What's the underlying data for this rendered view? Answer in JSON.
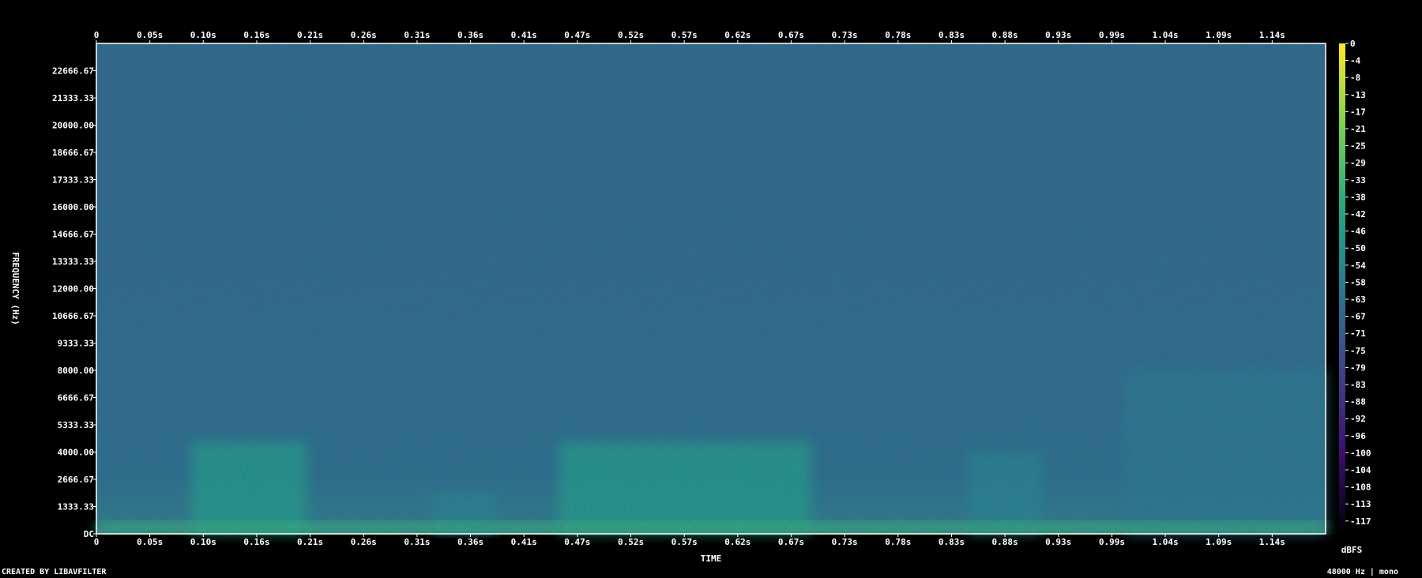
{
  "chart_data": {
    "type": "heatmap",
    "title": "",
    "xlabel": "TIME",
    "ylabel": "FREQUENCY (Hz)",
    "x_ticks": [
      "0",
      "0.05s",
      "0.10s",
      "0.16s",
      "0.21s",
      "0.26s",
      "0.31s",
      "0.36s",
      "0.41s",
      "0.47s",
      "0.52s",
      "0.57s",
      "0.62s",
      "0.67s",
      "0.73s",
      "0.78s",
      "0.83s",
      "0.88s",
      "0.93s",
      "0.99s",
      "1.04s",
      "1.09s",
      "1.14s"
    ],
    "x_range": [
      0,
      1.17
    ],
    "y_ticks": [
      "DC",
      "1333.33",
      "2666.67",
      "4000.00",
      "5333.33",
      "6666.67",
      "8000.00",
      "9333.33",
      "10666.67",
      "12000.00",
      "13333.33",
      "14666.67",
      "16000.00",
      "17333.33",
      "18666.67",
      "20000.00",
      "21333.33",
      "22666.67"
    ],
    "y_range": [
      0,
      24000
    ],
    "colorbar": {
      "label": "dBFS",
      "ticks": [
        "0",
        "-4",
        "-8",
        "-13",
        "-17",
        "-21",
        "-25",
        "-29",
        "-33",
        "-38",
        "-42",
        "-46",
        "-50",
        "-54",
        "-58",
        "-63",
        "-67",
        "-71",
        "-75",
        "-79",
        "-83",
        "-88",
        "-92",
        "-96",
        "-100",
        "-104",
        "-108",
        "-113",
        "-117"
      ],
      "range": [
        -120,
        0
      ],
      "colormap": [
        "#000004",
        "#3b0f70",
        "#414487",
        "#2a788e",
        "#22a884",
        "#7ad151",
        "#fde725"
      ]
    },
    "background_level_db": -75,
    "energy_regions": [
      {
        "t": [
          0.09,
          0.2
        ],
        "f": [
          0,
          4500
        ],
        "db": -45
      },
      {
        "t": [
          0.44,
          0.68
        ],
        "f": [
          0,
          4500
        ],
        "db": -45
      },
      {
        "t": [
          0.32,
          0.38
        ],
        "f": [
          0,
          2000
        ],
        "db": -55
      },
      {
        "t": [
          0.83,
          0.9
        ],
        "f": [
          0,
          4000
        ],
        "db": -55
      },
      {
        "t": [
          0.98,
          1.17
        ],
        "f": [
          0,
          8000
        ],
        "db": -60
      },
      {
        "t": [
          0.0,
          1.17
        ],
        "f": [
          0,
          600
        ],
        "db": -35
      }
    ]
  },
  "footer": {
    "left": "CREATED BY LIBAVFILTER",
    "right": "48000 Hz | mono"
  }
}
